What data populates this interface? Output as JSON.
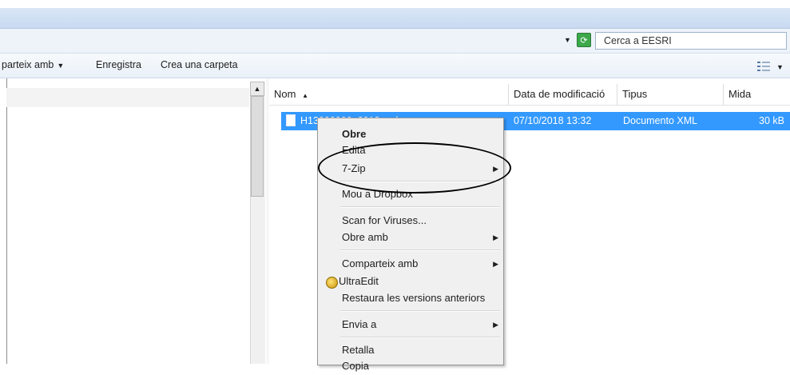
{
  "address": {
    "search_placeholder": "Cerca a EESRI"
  },
  "toolbar": {
    "share_label": "parteix amb",
    "save_label": "Enregistra",
    "new_folder_label": "Crea una carpeta"
  },
  "columns": [
    {
      "label": "Nom"
    },
    {
      "label": "Data de modificació"
    },
    {
      "label": "Tipus"
    },
    {
      "label": "Mida"
    }
  ],
  "file": {
    "name": "H13000000_2018.xml",
    "modified": "07/10/2018 13:32",
    "type": "Documento XML",
    "size": "30 kB"
  },
  "context_menu": {
    "items": [
      {
        "label": "Obre"
      },
      {
        "label": "Edita"
      },
      {
        "label": "7-Zip"
      },
      {
        "label": "Mou a Dropbox"
      },
      {
        "label": "Scan for Viruses..."
      },
      {
        "label": "Obre amb"
      },
      {
        "label": "Comparteix amb"
      },
      {
        "label": "UltraEdit"
      },
      {
        "label": "Restaura les versions anteriors"
      },
      {
        "label": "Envia a"
      },
      {
        "label": "Retalla"
      },
      {
        "label": "Copia"
      }
    ]
  },
  "icons": {
    "refresh": "refresh-icon",
    "file": "xml-file-icon",
    "ultraedit": "ultraedit-icon",
    "view": "view-options-icon"
  },
  "colors": {
    "selection": "#3399ff",
    "menu_bg": "#f0f0f0"
  }
}
